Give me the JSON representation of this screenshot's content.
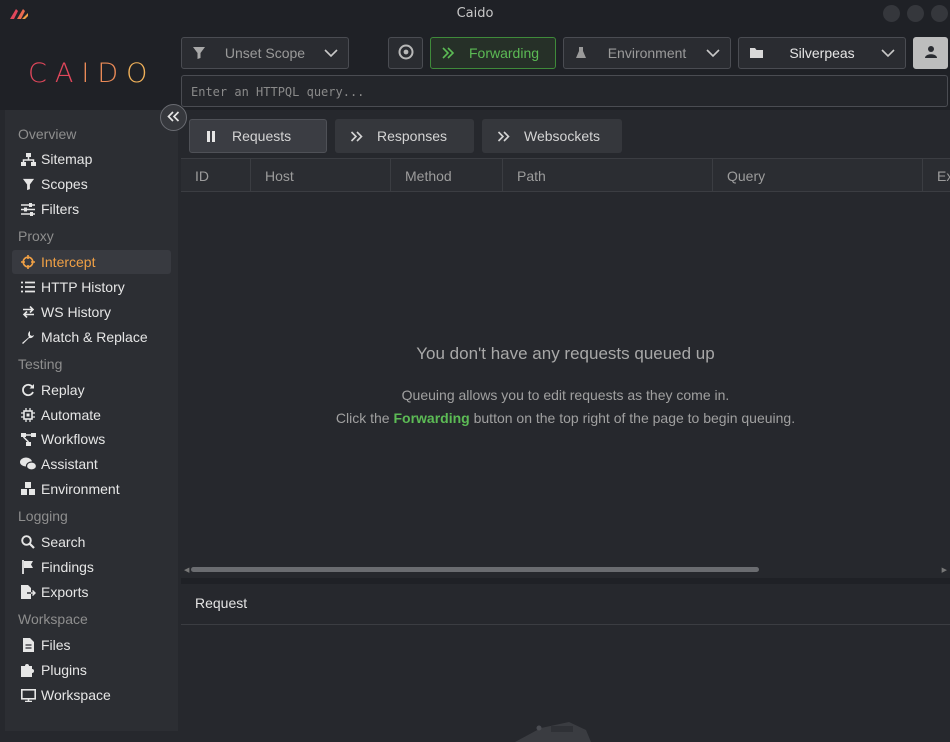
{
  "window": {
    "title": "Caido"
  },
  "brand": {
    "logo_text": "CAIDO",
    "accent": "#e0475b"
  },
  "toolbar": {
    "scope_label": "Unset Scope",
    "forwarding_label": "Forwarding",
    "environment_label": "Environment",
    "project_label": "Silverpeas",
    "query_placeholder": "Enter an HTTPQL query...",
    "forwarding_color": "#5cbb55"
  },
  "sidebar": {
    "sections": [
      {
        "label": "Overview",
        "items": [
          {
            "label": "Sitemap",
            "icon": "sitemap-icon"
          },
          {
            "label": "Scopes",
            "icon": "funnel-icon"
          },
          {
            "label": "Filters",
            "icon": "sliders-icon"
          }
        ]
      },
      {
        "label": "Proxy",
        "items": [
          {
            "label": "Intercept",
            "icon": "crosshair-icon",
            "active": true
          },
          {
            "label": "HTTP History",
            "icon": "list-icon"
          },
          {
            "label": "WS History",
            "icon": "arrows-icon"
          },
          {
            "label": "Match & Replace",
            "icon": "wrench-icon"
          }
        ]
      },
      {
        "label": "Testing",
        "items": [
          {
            "label": "Replay",
            "icon": "rotate-icon"
          },
          {
            "label": "Automate",
            "icon": "chip-icon"
          },
          {
            "label": "Workflows",
            "icon": "nodes-icon"
          },
          {
            "label": "Assistant",
            "icon": "chat-icon"
          },
          {
            "label": "Environment",
            "icon": "cubes-icon"
          }
        ]
      },
      {
        "label": "Logging",
        "items": [
          {
            "label": "Search",
            "icon": "search-icon"
          },
          {
            "label": "Findings",
            "icon": "flag-icon"
          },
          {
            "label": "Exports",
            "icon": "export-icon"
          }
        ]
      },
      {
        "label": "Workspace",
        "items": [
          {
            "label": "Files",
            "icon": "file-icon"
          },
          {
            "label": "Plugins",
            "icon": "puzzle-icon"
          },
          {
            "label": "Workspace",
            "icon": "monitor-icon"
          }
        ]
      }
    ]
  },
  "tabs": [
    {
      "label": "Requests",
      "selected": true
    },
    {
      "label": "Responses"
    },
    {
      "label": "Websockets"
    }
  ],
  "table": {
    "columns": [
      "ID",
      "Host",
      "Method",
      "Path",
      "Query",
      "Ex"
    ]
  },
  "empty": {
    "title": "You don't have any requests queued up",
    "line1": "Queuing allows you to edit requests as they come in.",
    "line2_pre": "Click the ",
    "line2_hl": "Forwarding",
    "line2_post": " button on the top right of the page to begin queuing."
  },
  "request_panel": {
    "title": "Request"
  }
}
